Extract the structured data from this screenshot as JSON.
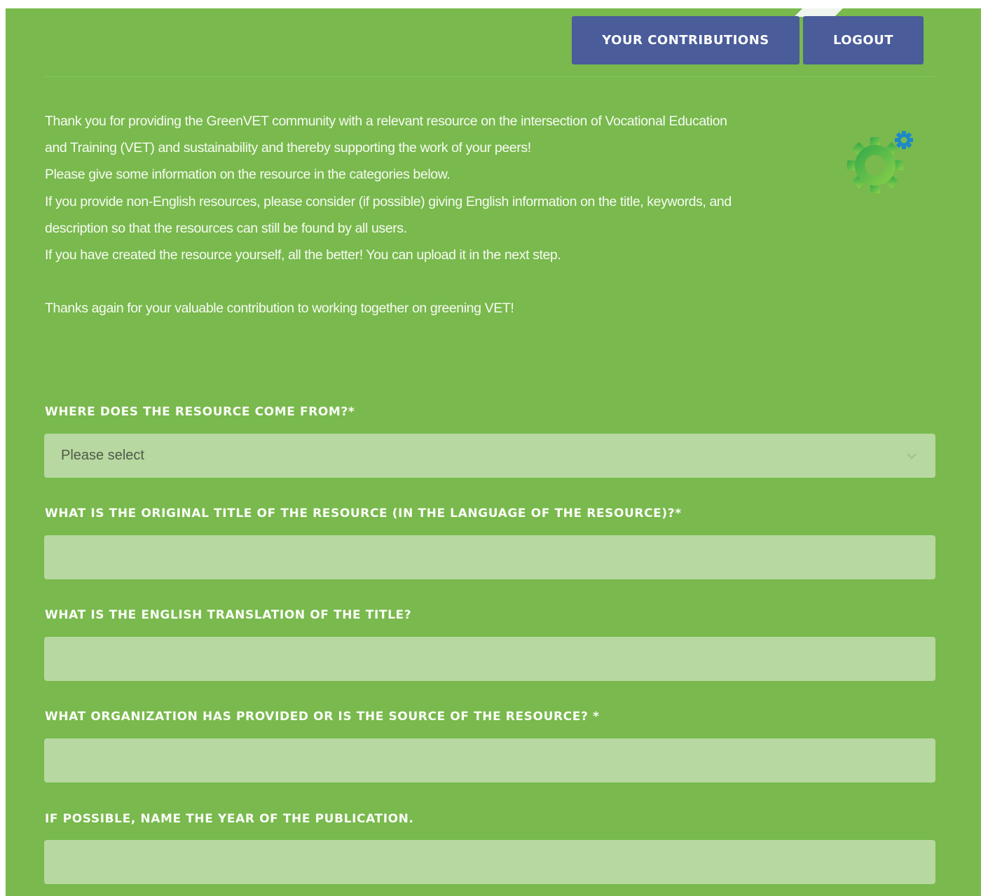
{
  "header": {
    "contributions_label": "YOUR CONTRIBUTIONS",
    "logout_label": "LOGOUT"
  },
  "intro": {
    "line1": "Thank you for providing the GreenVET community with a relevant resource on the intersection of Vocational Education",
    "line2": "and Training (VET) and sustainability and thereby supporting the work of your peers!",
    "line3": "Please give some information on the resource in the categories below.",
    "line4": "If you provide non-English resources, please consider (if possible) giving English information on the title, keywords, and",
    "line5": "description so that the resources can still be found by all users.",
    "line6": "If you have created the resource yourself, all the better! You can upload it in the next step.",
    "line7": "Thanks again for your valuable contribution to working together on greening VET!"
  },
  "logo": {
    "icon": "gear-icon",
    "colors": [
      "#3bb54a",
      "#1e88c9"
    ]
  },
  "form": {
    "source": {
      "label": "WHERE DOES THE RESOURCE COME FROM?*",
      "selected": "Please select"
    },
    "original_title": {
      "label": "WHAT IS THE ORIGINAL TITLE OF THE RESOURCE (IN THE LANGUAGE OF THE RESOURCE)?*",
      "value": ""
    },
    "english_title": {
      "label": "WHAT IS THE ENGLISH TRANSLATION OF THE TITLE?",
      "value": ""
    },
    "organization": {
      "label": "WHAT ORGANIZATION HAS PROVIDED OR IS THE SOURCE OF THE RESOURCE? *",
      "value": ""
    },
    "year": {
      "label": "IF POSSIBLE, NAME THE YEAR OF THE PUBLICATION.",
      "value": ""
    }
  },
  "colors": {
    "page_green": "#79b94d",
    "button_blue": "#4a5c99",
    "field_green": "#b7d8a0"
  }
}
